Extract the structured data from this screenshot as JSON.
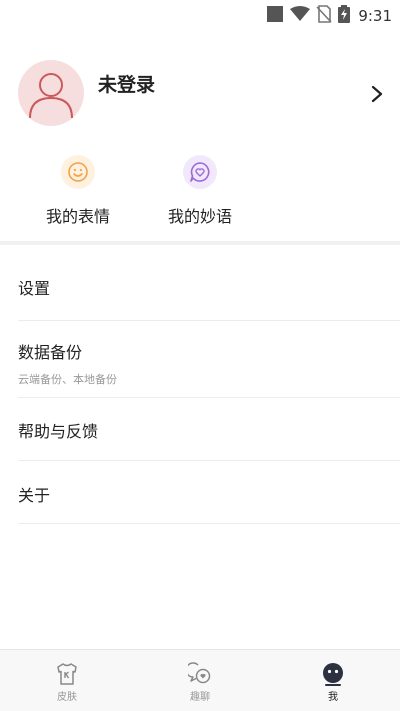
{
  "status_bar": {
    "time": "9:31",
    "icons": [
      "square-icon",
      "wifi-icon",
      "no-sim-icon",
      "battery-charging-icon"
    ]
  },
  "profile": {
    "name": "未登录",
    "avatar_icon": "user-avatar-icon",
    "arrow_icon": "chevron-right-icon"
  },
  "quick_actions": [
    {
      "label": "我的表情",
      "icon": "smiley-icon",
      "color": "#f2a34a",
      "bg": "#fff1e0"
    },
    {
      "label": "我的妙语",
      "icon": "heart-chat-icon",
      "color": "#9b6ad6",
      "bg": "#f1e8fb"
    }
  ],
  "menu": [
    {
      "title": "设置",
      "subtitle": ""
    },
    {
      "title": "数据备份",
      "subtitle": "云端备份、本地备份"
    },
    {
      "title": "帮助与反馈",
      "subtitle": ""
    },
    {
      "title": "关于",
      "subtitle": ""
    }
  ],
  "bottom_nav": [
    {
      "label": "皮肤",
      "icon": "shirt-icon",
      "active": false
    },
    {
      "label": "趣聊",
      "icon": "chat-bubbles-icon",
      "active": false
    },
    {
      "label": "我",
      "icon": "face-icon",
      "active": true
    }
  ],
  "colors": {
    "accent_dark": "#2b3140",
    "avatar_bg": "#f7dede",
    "avatar_line": "#c9595b"
  }
}
